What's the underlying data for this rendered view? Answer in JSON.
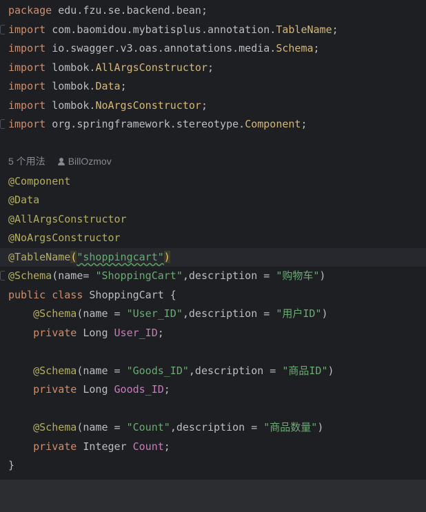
{
  "code": {
    "package_line": {
      "keyword": "package",
      "name": "edu.fzu.se.backend.bean",
      "semicolon": ";"
    },
    "imports": [
      {
        "keyword": "import",
        "pkg": "com.baomidou.mybatisplus.annotation.",
        "cls": "TableName",
        "semicolon": ";"
      },
      {
        "keyword": "import",
        "pkg": "io.swagger.v3.oas.annotations.media.",
        "cls": "Schema",
        "semicolon": ";"
      },
      {
        "keyword": "import",
        "pkg": "lombok.",
        "cls": "AllArgsConstructor",
        "semicolon": ";"
      },
      {
        "keyword": "import",
        "pkg": "lombok.",
        "cls": "Data",
        "semicolon": ";"
      },
      {
        "keyword": "import",
        "pkg": "lombok.",
        "cls": "NoArgsConstructor",
        "semicolon": ";"
      },
      {
        "keyword": "import",
        "pkg": "org.springframework.stereotype.",
        "cls": "Component",
        "semicolon": ";"
      }
    ],
    "inlay_hint": {
      "usages": "5 个用法",
      "author": "BillOzmov"
    },
    "annotations": [
      "@Component",
      "@Data",
      "@AllArgsConstructor",
      "@NoArgsConstructor"
    ],
    "table_name": {
      "ann": "@TableName",
      "open": "(",
      "value": "\"shoppingcart\"",
      "close": ")"
    },
    "class_schema": {
      "ann": "@Schema",
      "open": "(name= ",
      "name": "\"ShoppingCart\"",
      "mid": ",description = ",
      "desc": "\"购物车\"",
      "close": ")"
    },
    "class_decl": {
      "kw1": "public",
      "kw2": "class",
      "name": "ShoppingCart",
      "brace": " {"
    },
    "fields": [
      {
        "schema": {
          "ann": "@Schema",
          "open": "(name = ",
          "name": "\"User_ID\"",
          "mid": ",description = ",
          "desc": "\"用户ID\"",
          "close": ")"
        },
        "decl": {
          "kw": "private",
          "type": "Long",
          "name": "User_ID",
          "semicolon": ";"
        }
      },
      {
        "schema": {
          "ann": "@Schema",
          "open": "(name = ",
          "name": "\"Goods_ID\"",
          "mid": ",description = ",
          "desc": "\"商品ID\"",
          "close": ")"
        },
        "decl": {
          "kw": "private",
          "type": "Long",
          "name": "Goods_ID",
          "semicolon": ";"
        }
      },
      {
        "schema": {
          "ann": "@Schema",
          "open": "(name = ",
          "name": "\"Count\"",
          "mid": ",description = ",
          "desc": "\"商品数量\"",
          "close": ")"
        },
        "decl": {
          "kw": "private",
          "type": "Integer",
          "name": "Count",
          "semicolon": ";"
        }
      }
    ],
    "closing_brace": "}"
  },
  "colors": {
    "background": "#1e1f22",
    "keyword": "#cf8e6d",
    "class": "#d5b778",
    "annotation": "#b3ae60",
    "string": "#6aab73",
    "field": "#c77dbb",
    "text": "#bcbec4"
  }
}
